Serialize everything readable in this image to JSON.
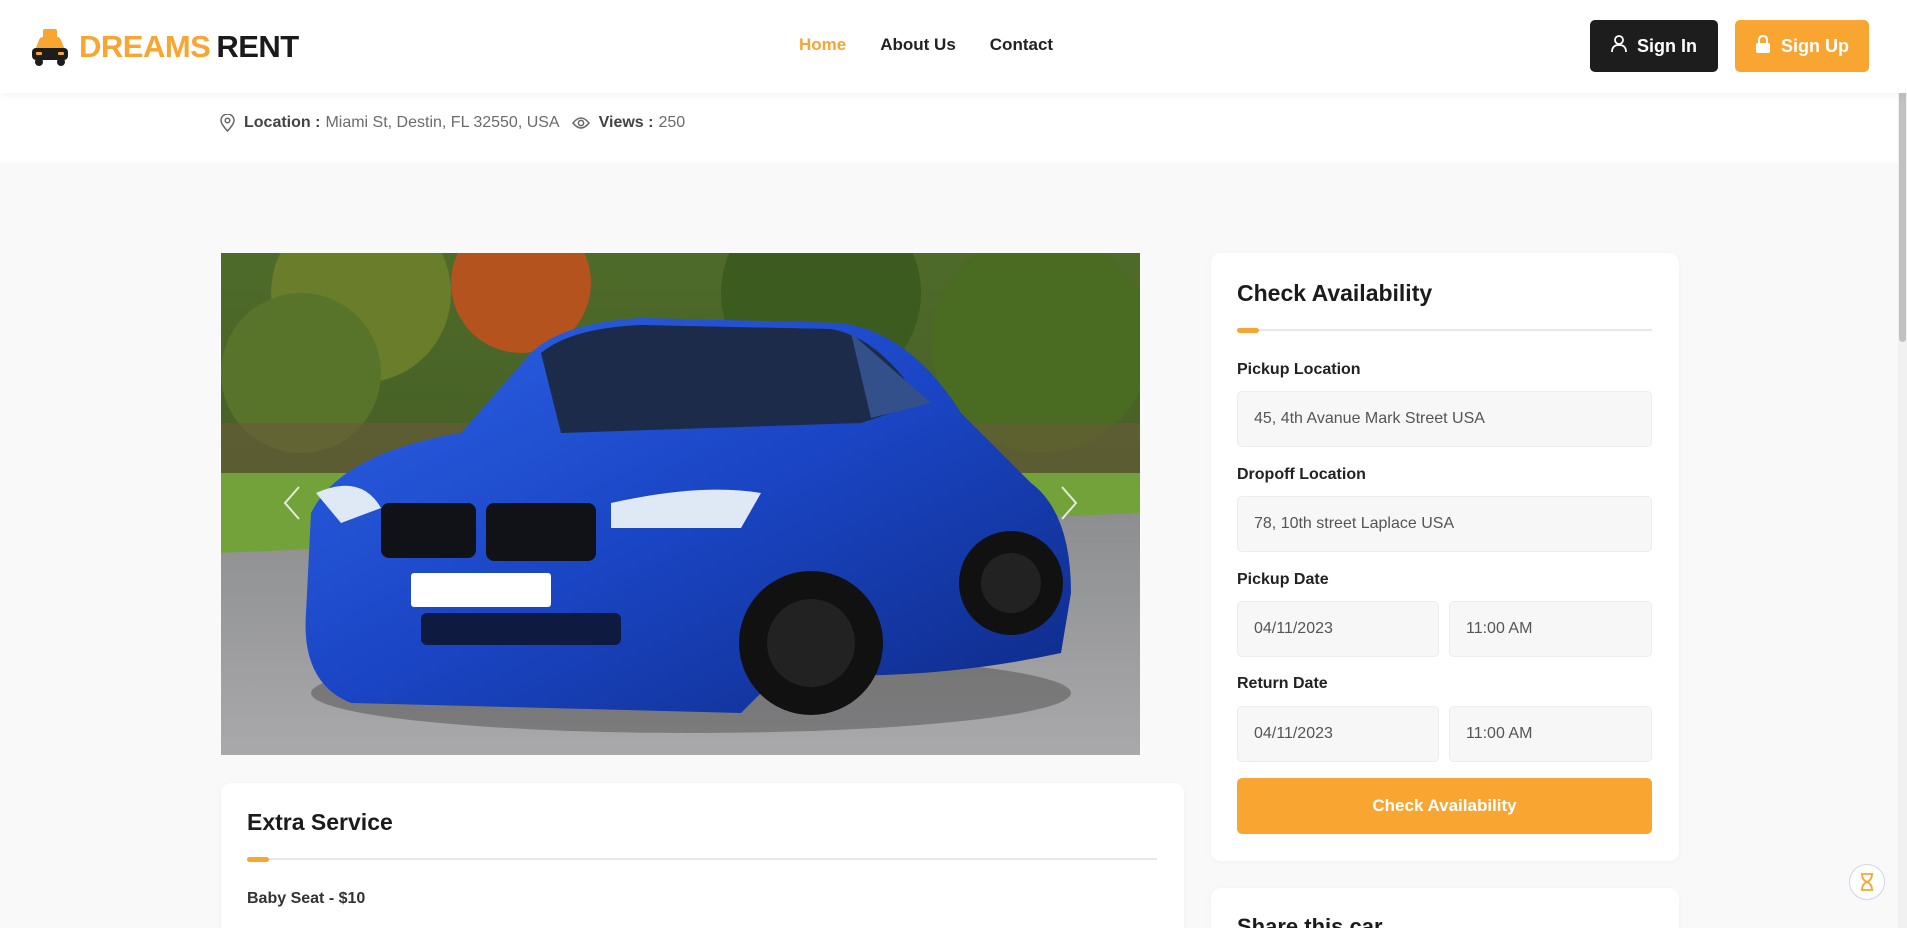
{
  "brand": {
    "name_part1": "DREAMS",
    "name_part2": "RENT",
    "accent_color": "#f9a532"
  },
  "nav": {
    "items": [
      {
        "label": "Home",
        "active": true
      },
      {
        "label": "About Us",
        "active": false
      },
      {
        "label": "Contact",
        "active": false
      }
    ]
  },
  "auth": {
    "signin_label": "Sign In",
    "signup_label": "Sign Up"
  },
  "listing_meta": {
    "location_label": "Location :",
    "location_value": "Miami St, Destin, FL 32550, USA",
    "views_label": "Views :",
    "views_value": "250"
  },
  "gallery": {
    "icons": [
      "chevron-left-icon",
      "chevron-right-icon"
    ]
  },
  "extra_service": {
    "title": "Extra Service",
    "items": [
      "Baby Seat - $10"
    ]
  },
  "availability": {
    "title": "Check Availability",
    "pickup_location_label": "Pickup Location",
    "pickup_location_value": "45, 4th Avanue  Mark Street USA",
    "dropoff_location_label": "Dropoff Location",
    "dropoff_location_value": "78, 10th street Laplace USA",
    "pickup_date_label": "Pickup Date",
    "pickup_date_value": "04/11/2023",
    "pickup_time_value": "11:00 AM",
    "return_date_label": "Return Date",
    "return_date_value": "04/11/2023",
    "return_time_value": "11:00 AM",
    "button_label": "Check Availability"
  },
  "share": {
    "title": "Share this car"
  }
}
